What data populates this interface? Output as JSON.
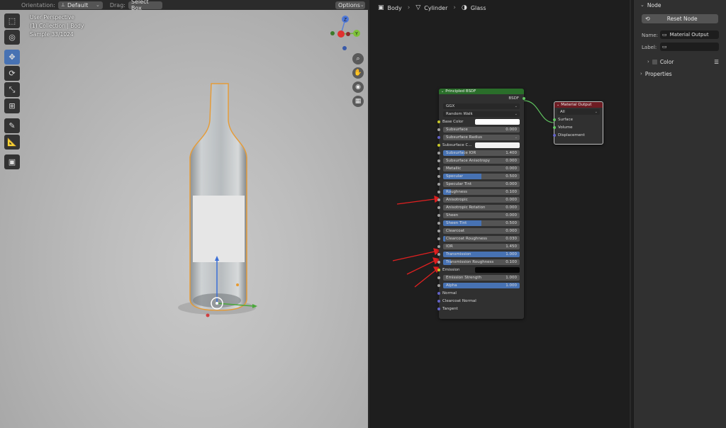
{
  "viewport": {
    "orientation_label": "Orientation:",
    "orientation_value": "Default",
    "drag_label": "Drag:",
    "drag_value": "Select Box",
    "options_label": "Options",
    "info_line1": "User Perspective",
    "info_line2": "(1) Collection | Body",
    "info_line3": "Sample 33/1024",
    "gizmo_z": "Z",
    "gizmo_y": "Y"
  },
  "node_editor": {
    "breadcrumbs": [
      "Body",
      "Cylinder",
      "Glass"
    ],
    "bsdf": {
      "title": "Principled BSDF",
      "output": "BSDF",
      "distribution": "GGX",
      "subsurface_method": "Random Walk",
      "base_color_label": "Base Color",
      "base_color": "#ffffff",
      "subsurface_radius": "Subsurface Radius",
      "subsurface_color_label": "Subsurface C...",
      "subsurface_color": "#f2f2f2",
      "emission_label": "Emission",
      "emission_color": "#080808",
      "sliders": [
        {
          "label": "Subsurface",
          "value": "0.000",
          "fill": 0
        },
        {
          "label": "Subsurface IOR",
          "value": "1.400",
          "fill": 0.28
        },
        {
          "label": "Subsurface Anisotropy",
          "value": "0.000",
          "fill": 0
        },
        {
          "label": "Metallic",
          "value": "0.000",
          "fill": 0
        },
        {
          "label": "Specular",
          "value": "0.500",
          "fill": 0.5
        },
        {
          "label": "Specular Tint",
          "value": "0.000",
          "fill": 0
        },
        {
          "label": "Roughness",
          "value": "0.100",
          "fill": 0.1
        },
        {
          "label": "Anisotropic",
          "value": "0.000",
          "fill": 0
        },
        {
          "label": "Anisotropic Rotation",
          "value": "0.000",
          "fill": 0
        },
        {
          "label": "Sheen",
          "value": "0.000",
          "fill": 0
        },
        {
          "label": "Sheen Tint",
          "value": "0.500",
          "fill": 0.5
        },
        {
          "label": "Clearcoat",
          "value": "0.000",
          "fill": 0
        },
        {
          "label": "Clearcoat Roughness",
          "value": "0.030",
          "fill": 0.03
        },
        {
          "label": "IOR",
          "value": "1.450",
          "fill": 0
        },
        {
          "label": "Transmission",
          "value": "1.000",
          "fill": 1
        },
        {
          "label": "Transmission Roughness",
          "value": "0.100",
          "fill": 0.1
        }
      ],
      "emission_strength": {
        "label": "Emission Strength",
        "value": "1.000"
      },
      "alpha": {
        "label": "Alpha",
        "value": "1.000",
        "fill": 1
      },
      "vector_inputs": [
        "Normal",
        "Clearcoat Normal",
        "Tangent"
      ]
    },
    "material_output": {
      "title": "Material Output",
      "target": "All",
      "inputs": [
        "Surface",
        "Volume",
        "Displacement"
      ]
    }
  },
  "properties": {
    "node_section": "Node",
    "reset_node": "Reset Node",
    "name_label": "Name:",
    "name_value": "Material Output",
    "label_label": "Label:",
    "label_value": "",
    "color_section": "Color",
    "properties_section": "Properties"
  },
  "colors": {
    "accent": "#4772b3",
    "shader_header": "#2a6e2a",
    "output_header": "#6e1c23",
    "annotation_arrow": "#e02020",
    "selection_outline": "#f0a030"
  }
}
